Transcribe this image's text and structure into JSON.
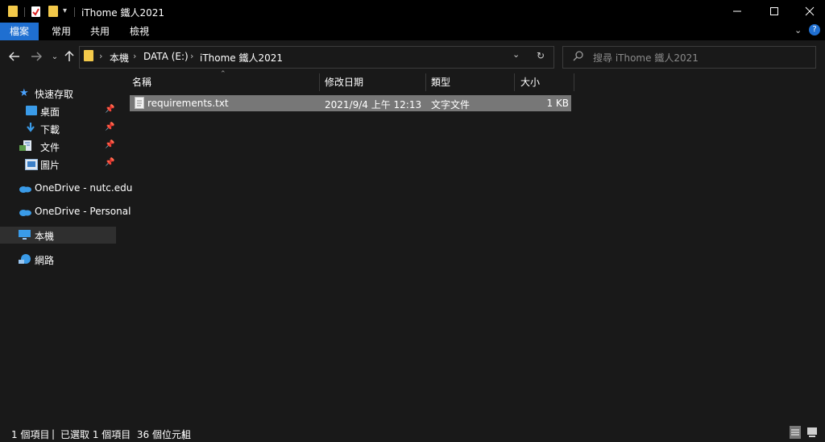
{
  "window": {
    "title": "iThome 鐵人2021"
  },
  "ribbon": {
    "tabs": [
      "檔案",
      "常用",
      "共用",
      "檢視"
    ]
  },
  "nav": {
    "breadcrumb": [
      "本機",
      "DATA (E:)",
      "iThome 鐵人2021"
    ],
    "search_placeholder": "搜尋 iThome 鐵人2021"
  },
  "sidebar": {
    "quick_access": "快速存取",
    "items": [
      {
        "label": "桌面",
        "icon": "desktop-icon",
        "pinned": true
      },
      {
        "label": "下載",
        "icon": "download-icon",
        "pinned": true
      },
      {
        "label": "文件",
        "icon": "documents-icon",
        "pinned": true
      },
      {
        "label": "圖片",
        "icon": "pictures-icon",
        "pinned": true
      }
    ],
    "onedrive_1": "OneDrive - nutc.edu",
    "onedrive_2": "OneDrive - Personal",
    "computer": "本機",
    "network": "網路"
  },
  "columns": [
    "名稱",
    "修改日期",
    "類型",
    "大小"
  ],
  "files": [
    {
      "name": "requirements.txt",
      "modified": "2021/9/4 上午 12:13",
      "type": "文字文件",
      "size": "1 KB"
    }
  ],
  "status": {
    "count": "1 個項目",
    "selected": "已選取 1 個項目  36 個位元組"
  },
  "colors": {
    "accent": "#1f6fd1",
    "folder": "#f3c94a",
    "selection": "#777777"
  }
}
